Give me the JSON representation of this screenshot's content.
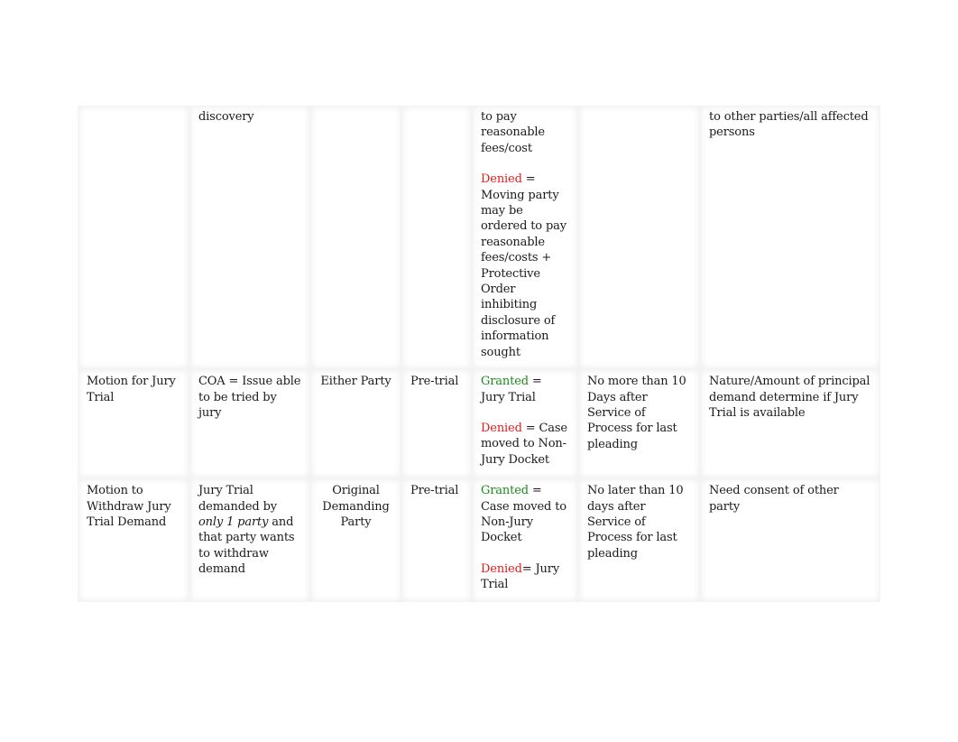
{
  "document": {
    "type": "motions-reference-table",
    "colors": {
      "granted": "#1e8a1e",
      "denied": "#e01b1b",
      "text": "#1a1a1a"
    },
    "rows": [
      {
        "motion": "",
        "coa": "discovery",
        "who": "",
        "when": "",
        "outcome": {
          "lead_text": "to pay reasonable fees/cost",
          "denied_label": "Denied",
          "denied_text": " = Moving party may be ordered to pay reasonable fees/costs + Protective Order inhibiting disclosure of information sought"
        },
        "deadline": "",
        "notes": "to other parties/all affected persons"
      },
      {
        "motion": "Motion for Jury Trial",
        "coa": "COA = Issue able to be tried by jury",
        "who": "Either Party",
        "when": "Pre-trial",
        "outcome": {
          "granted_label": "Granted",
          "granted_text": " = Jury Trial",
          "denied_label": "Denied",
          "denied_text": " = Case moved to Non-Jury Docket"
        },
        "deadline": "No more than 10 Days after Service of Process for last pleading",
        "notes": "Nature/Amount of principal demand determine if Jury Trial is available"
      },
      {
        "motion": "Motion to Withdraw Jury Trial Demand",
        "coa": {
          "before": "Jury Trial demanded by ",
          "italic": "only 1 party",
          "after": " and that party wants to withdraw demand"
        },
        "who": "Original Demanding Party",
        "when": "Pre-trial",
        "outcome": {
          "granted_label": "Granted",
          "granted_text": " = Case moved to Non-Jury Docket",
          "denied_label": "Denied",
          "denied_text": "= Jury Trial"
        },
        "deadline": "No later than 10 days after Service of Process for last pleading",
        "notes": "Need consent of other party"
      }
    ]
  }
}
